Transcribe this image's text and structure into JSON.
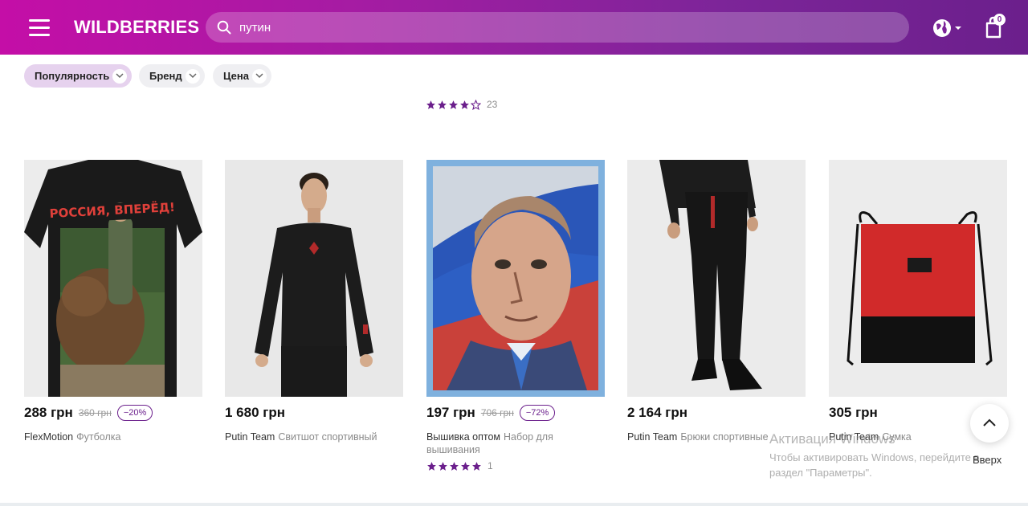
{
  "header": {
    "logo": "WILDBERRIES",
    "search_value": "путин",
    "cart_count": "0"
  },
  "filters": [
    {
      "label": "Популярность",
      "active": true
    },
    {
      "label": "Бренд",
      "active": false
    },
    {
      "label": "Цена",
      "active": false
    }
  ],
  "top_rating": {
    "stars": 4,
    "count": "23"
  },
  "products": [
    {
      "price": "288 грн",
      "old_price": "360 грн",
      "discount": "−20%",
      "brand": "FlexMotion",
      "name": "Футболка"
    },
    {
      "price": "1 680 грн",
      "brand": "Putin Team",
      "name": "Свитшот спортивный"
    },
    {
      "price": "197 грн",
      "old_price": "706 грн",
      "discount": "−72%",
      "brand": "Вышивка оптом",
      "name": "Набор для вышивания",
      "rating": {
        "stars": 5,
        "count": "1"
      }
    },
    {
      "price": "2 164 грн",
      "brand": "Putin Team",
      "name": "Брюки спортивные"
    },
    {
      "price": "305 грн",
      "brand": "Putin Team",
      "name": "Сумка"
    }
  ],
  "scroll_top_label": "Вверх",
  "windows_watermark": {
    "title": "Активация Windows",
    "text": "Чтобы активировать Windows, перейдите в раздел \"Параметры\"."
  },
  "colors": {
    "brand_gradient_start": "#c40ea7",
    "brand_gradient_end": "#6b1f8c",
    "accent": "#6b1f8c"
  }
}
